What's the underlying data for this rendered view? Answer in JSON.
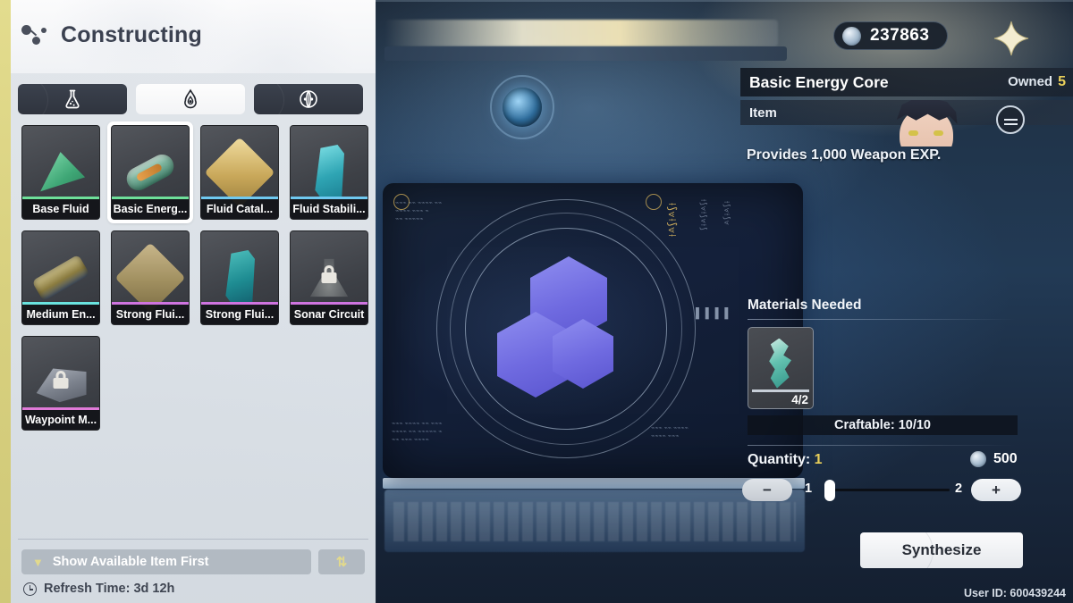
{
  "header": {
    "title": "Constructing",
    "icon": "molecule-icon"
  },
  "tabs": [
    {
      "id": "flask",
      "icon": "flask-icon",
      "active": false
    },
    {
      "id": "fluid",
      "icon": "flame-droplet-icon",
      "active": true
    },
    {
      "id": "device",
      "icon": "circular-emblem-icon",
      "active": false
    }
  ],
  "items": [
    {
      "label": "Base Fluid",
      "art": "tri",
      "rarity": "#6ee09a",
      "locked": false,
      "selected": false
    },
    {
      "label": "Basic Energ...",
      "art": "vial",
      "rarity": "#6ee09a",
      "locked": false,
      "selected": true
    },
    {
      "label": "Fluid Catal...",
      "art": "diamond",
      "rarity": "#6fc9f0",
      "locked": false,
      "selected": false
    },
    {
      "label": "Fluid Stabili...",
      "art": "crystal",
      "rarity": "#6fc9f0",
      "locked": false,
      "selected": false
    },
    {
      "label": "Medium En...",
      "art": "cyl",
      "rarity": "#6ae4e0",
      "locked": false,
      "selected": false
    },
    {
      "label": "Strong Flui...",
      "art": "diamond-dim",
      "rarity": "#cf74e0",
      "locked": false,
      "selected": false
    },
    {
      "label": "Strong Flui...",
      "art": "crystal-dark",
      "rarity": "#cf74e0",
      "locked": false,
      "selected": false
    },
    {
      "label": "Sonar Circuit",
      "art": "flask-art",
      "rarity": "#cf74e0",
      "locked": true,
      "selected": false
    },
    {
      "label": "Waypoint M...",
      "art": "box3d",
      "rarity": "#e07ad8",
      "locked": true,
      "selected": false
    }
  ],
  "left_bottom": {
    "sort_label": "Show Available Item First",
    "sort_chevron": "chevron-down-icon",
    "sort_toggle_glyph": "⇅",
    "refresh_label": "Refresh Time: 3d 12h",
    "refresh_icon": "clock-icon"
  },
  "topbar": {
    "currency_icon": "silver-coin-icon",
    "currency_value": "237863",
    "close_icon": "four-point-star-close-icon"
  },
  "detail": {
    "item_name": "Basic Energy Core",
    "owned_label": "Owned",
    "owned_value": "5",
    "item_type": "Item",
    "description": "Provides 1,000 Weapon EXP.",
    "avatar_badge_icon": "switch-character-icon"
  },
  "materials": {
    "heading": "Materials Needed",
    "slots": [
      {
        "icon": "teal-crystal-icon",
        "count": "4/2"
      }
    ],
    "craftable": "Craftable: 10/10"
  },
  "quantity": {
    "label": "Quantity:",
    "value": "1",
    "cost_icon": "silver-coin-icon",
    "cost_value": "500",
    "minus_glyph": "−",
    "plus_glyph": "+",
    "min": "1",
    "max": "2"
  },
  "actions": {
    "synthesize_label": "Synthesize"
  },
  "footer": {
    "user_id": "User ID: 600439244"
  }
}
